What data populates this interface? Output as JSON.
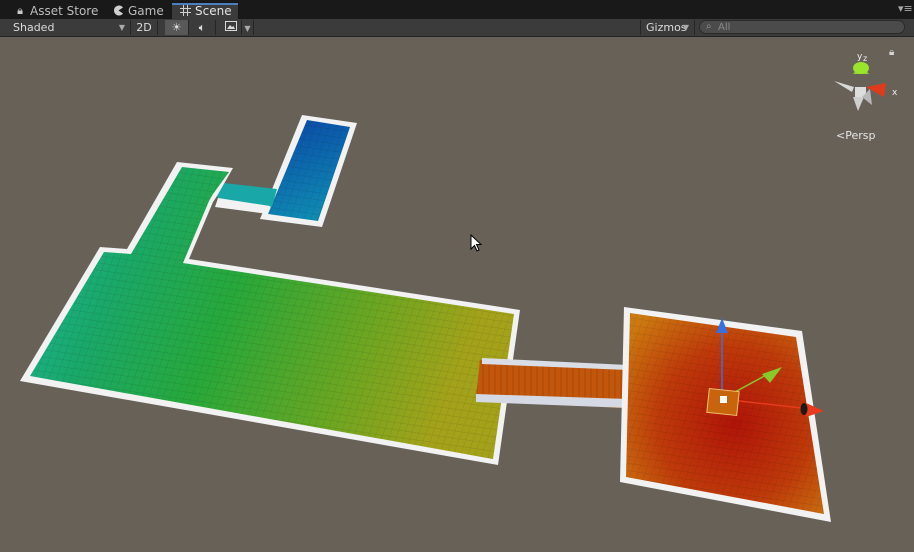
{
  "tabs": [
    {
      "label": "Asset Store",
      "icon": "lock-icon",
      "active": false
    },
    {
      "label": "Game",
      "icon": "pacman-icon",
      "active": false
    },
    {
      "label": "Scene",
      "icon": "grid-icon",
      "active": true
    }
  ],
  "toolbar": {
    "draw_mode": "Shaded",
    "mode_2d": "2D",
    "lighting_icon": "sun-icon",
    "audio_icon": "speaker-icon",
    "effects_icon": "image-icon",
    "gizmos": "Gizmos",
    "search_placeholder": "All"
  },
  "viewport": {
    "projection_label": "Persp",
    "gizmo_axes": {
      "x": "x",
      "y": "y",
      "z": "z"
    },
    "colors": {
      "background": "#686158",
      "wall": "#f2f2f2",
      "floor_blue": "#0a4da9",
      "floor_teal": "#1aa89a",
      "floor_green": "#22a832",
      "floor_yellow": "#a8a318",
      "floor_red": "#b51a08",
      "floor_orange": "#c8680c",
      "axis_x": "#e83a1c",
      "axis_y": "#88c82a",
      "axis_z": "#3a6fe0"
    }
  }
}
